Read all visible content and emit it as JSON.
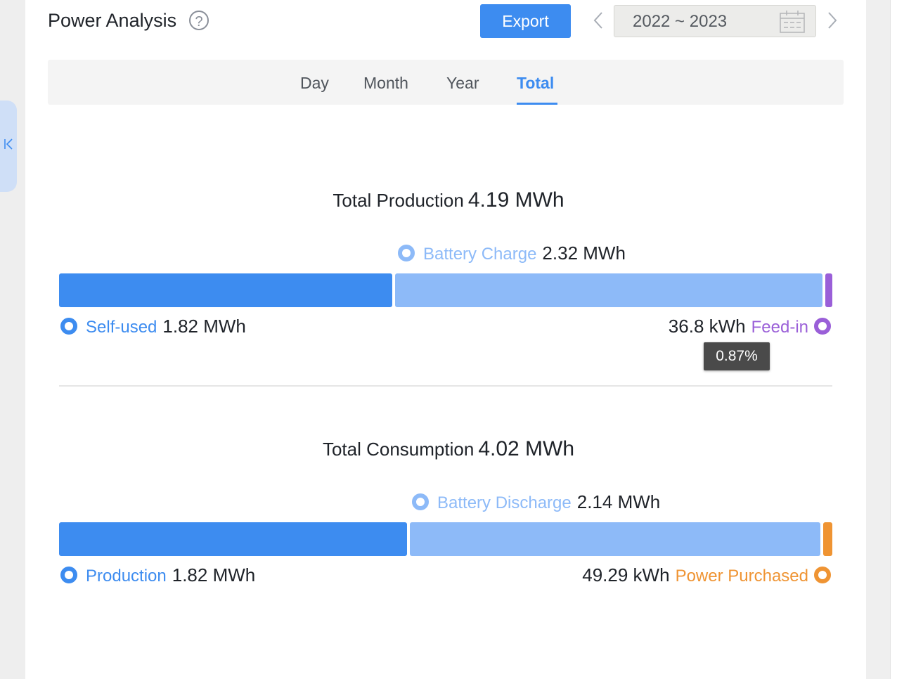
{
  "header": {
    "title": "Power Analysis",
    "help_icon": "question-circle-icon",
    "export_label": "Export",
    "prev_icon": "chevron-left-icon",
    "next_icon": "chevron-right-icon",
    "date_range": "2022 ~ 2023",
    "calendar_icon": "calendar-icon"
  },
  "tabs": [
    {
      "label": "Day",
      "active": false
    },
    {
      "label": "Month",
      "active": false
    },
    {
      "label": "Year",
      "active": false
    },
    {
      "label": "Total",
      "active": true
    }
  ],
  "production": {
    "title": "Total Production",
    "total": "4.19 MWh",
    "battery_charge": {
      "label": "Battery Charge",
      "value": "2.32 MWh"
    },
    "self_used": {
      "label": "Self-used",
      "value": "1.82 MWh"
    },
    "feed_in": {
      "label": "Feed-in",
      "value": "36.8 kWh"
    },
    "feed_in_tooltip": "0.87%",
    "shares": {
      "self_used": 0.434,
      "battery_charge": 0.553,
      "feed_in": 0.0088
    }
  },
  "consumption": {
    "title": "Total Consumption",
    "total": "4.02 MWh",
    "battery_discharge": {
      "label": "Battery Discharge",
      "value": "2.14 MWh"
    },
    "production": {
      "label": "Production",
      "value": "1.82 MWh"
    },
    "power_purchased": {
      "label": "Power Purchased",
      "value": "49.29 kWh"
    },
    "shares": {
      "production": 0.453,
      "battery_discharge": 0.532,
      "power_purchased": 0.0123
    }
  },
  "colors": {
    "primary": "#3d8cf0",
    "light_blue": "#8dbaf8",
    "purple": "#9a5fd8",
    "orange": "#ef9433"
  },
  "sidebar_toggle_icon": "collapse-left-icon"
}
